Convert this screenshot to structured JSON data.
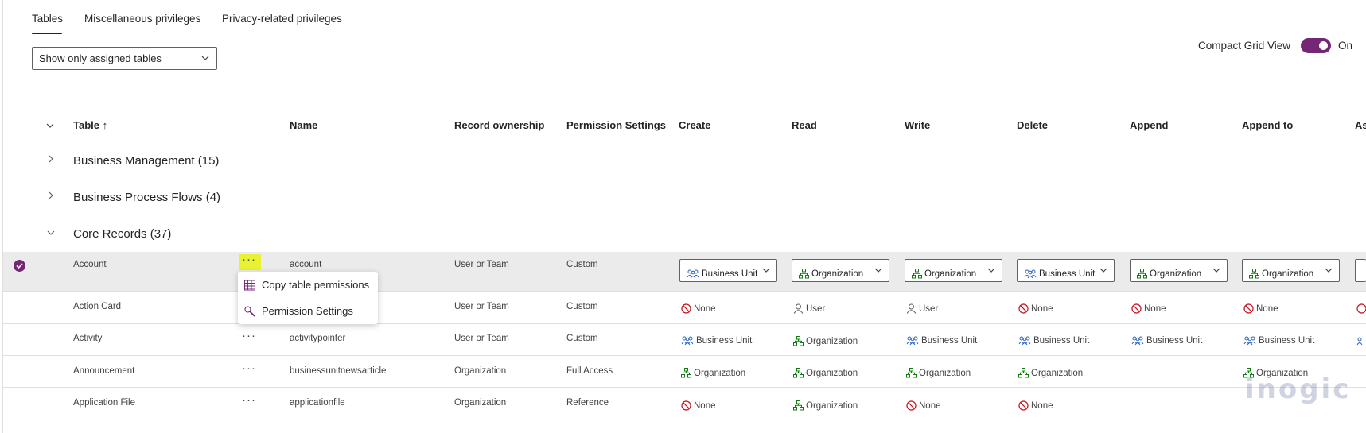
{
  "tabs": [
    {
      "label": "Tables",
      "active": true
    },
    {
      "label": "Miscellaneous privileges",
      "active": false
    },
    {
      "label": "Privacy-related privileges",
      "active": false
    }
  ],
  "filter": {
    "selected": "Show only assigned tables"
  },
  "compact_grid": {
    "label": "Compact Grid View",
    "state": "On",
    "enabled": true
  },
  "columns": {
    "table": "Table ↑",
    "name": "Name",
    "ownership": "Record ownership",
    "permission": "Permission Settings",
    "create": "Create",
    "read": "Read",
    "write": "Write",
    "delete": "Delete",
    "append": "Append",
    "append_to": "Append to",
    "assign": "As"
  },
  "groups": [
    {
      "label": "Business Management (15)",
      "expanded": false
    },
    {
      "label": "Business Process Flows (4)",
      "expanded": false
    },
    {
      "label": "Core Records (37)",
      "expanded": true
    }
  ],
  "rows": [
    {
      "table": "Account",
      "name": "account",
      "ownership": "User or Team",
      "permission": "Custom",
      "privileges": [
        "Business Unit",
        "Organization",
        "Organization",
        "Business Unit",
        "Organization",
        "Organization"
      ]
    },
    {
      "table": "Action Card",
      "name": "",
      "ownership": "User or Team",
      "permission": "Custom",
      "privileges": [
        "None",
        "User",
        "User",
        "None",
        "None",
        "None"
      ]
    },
    {
      "table": "Activity",
      "name": "activitypointer",
      "ownership": "User or Team",
      "permission": "Custom",
      "privileges": [
        "Business Unit",
        "Organization",
        "Business Unit",
        "Business Unit",
        "Business Unit",
        "Business Unit"
      ]
    },
    {
      "table": "Announcement",
      "name": "businessunitnewsarticle",
      "ownership": "Organization",
      "permission": "Full Access",
      "privileges": [
        "Organization",
        "Organization",
        "Organization",
        "Organization",
        "",
        "Organization"
      ]
    },
    {
      "table": "Application File",
      "name": "applicationfile",
      "ownership": "Organization",
      "permission": "Reference",
      "privileges": [
        "None",
        "Organization",
        "None",
        "None",
        "",
        ""
      ]
    }
  ],
  "context_menu": {
    "items": [
      {
        "label": "Copy table permissions",
        "icon": "table-grid-icon"
      },
      {
        "label": "Permission Settings",
        "icon": "wrench-icon"
      }
    ]
  },
  "watermark": "inogic",
  "colors": {
    "accent": "#742774",
    "none_red": "#c50f1f",
    "org_green": "#107c10",
    "bu_blue": "#2c64c4",
    "highlight": "#e8f232"
  }
}
